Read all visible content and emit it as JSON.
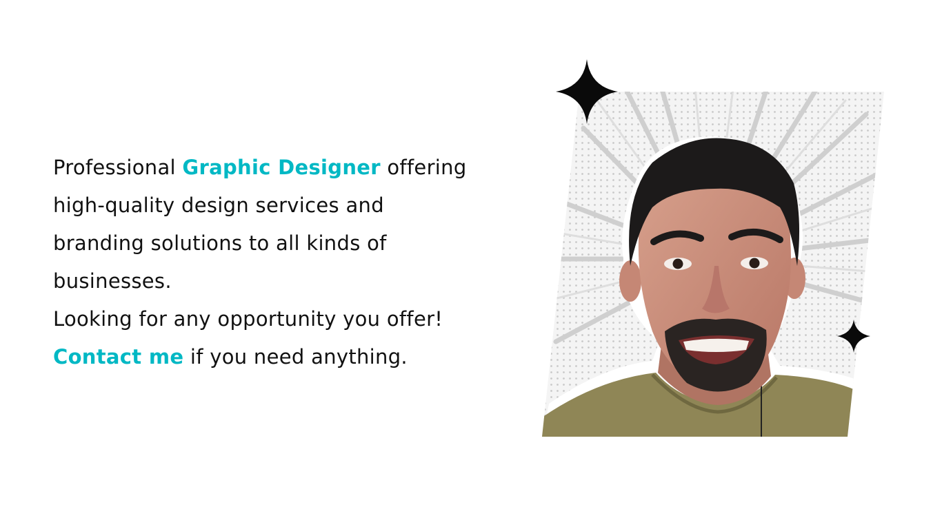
{
  "bio": {
    "line1_prefix": "Professional ",
    "line1_highlight": "Graphic Designer",
    "line1_suffix": " offering",
    "line2": "high-quality design services and",
    "line3": "branding solutions to all kinds of",
    "line4": "businesses.",
    "line5": "Looking for any opportunity you offer!",
    "line6_highlight": "Contact me",
    "line6_suffix": " if you need anything."
  },
  "colors": {
    "accent": "#00b8c4",
    "text": "#111111",
    "background": "#ffffff"
  },
  "portrait": {
    "icons": [
      "sparkle-star-icon",
      "sparkle-star-icon"
    ]
  }
}
